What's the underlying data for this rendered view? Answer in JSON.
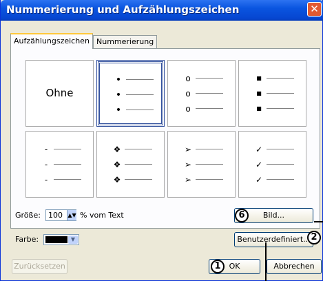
{
  "dialog": {
    "title": "Nummerierung und Aufzählungszeichen",
    "close_glyph": "✕"
  },
  "tabs": [
    {
      "label": "Aufzählungszeichen",
      "active": true
    },
    {
      "label": "Nummerierung",
      "active": false
    }
  ],
  "bullet_styles": {
    "none_label": "Ohne",
    "rows": [
      [
        {
          "symbol": "",
          "icon": "none"
        },
        {
          "symbol": "•",
          "icon": "dot-bullet-icon",
          "selected": true
        },
        {
          "symbol": "o",
          "icon": "circle-bullet-icon"
        },
        {
          "symbol": "■",
          "icon": "square-bullet-icon"
        }
      ],
      [
        {
          "symbol": "-",
          "icon": "dash-bullet-icon"
        },
        {
          "symbol": "❖",
          "icon": "diamond-cluster-bullet-icon"
        },
        {
          "symbol": "➢",
          "icon": "arrow-bullet-icon"
        },
        {
          "symbol": "✓",
          "icon": "checkmark-bullet-icon"
        }
      ]
    ]
  },
  "size": {
    "label": "Größe:",
    "value": "100",
    "suffix": "% vom Text"
  },
  "color": {
    "label": "Farbe:",
    "value_hex": "#000000"
  },
  "buttons": {
    "picture": "Bild...",
    "custom": "Benutzerdefiniert...",
    "reset": "Zurücksetzen",
    "ok": "OK",
    "cancel": "Abbrechen"
  },
  "callouts": {
    "picture": "6",
    "custom": "2",
    "ok": "1"
  },
  "colors": {
    "titlebar": "#0a55e0",
    "dialog_bg": "#ece9d8",
    "selection": "#34529e",
    "active_tab_accent": "#ffc83c"
  }
}
